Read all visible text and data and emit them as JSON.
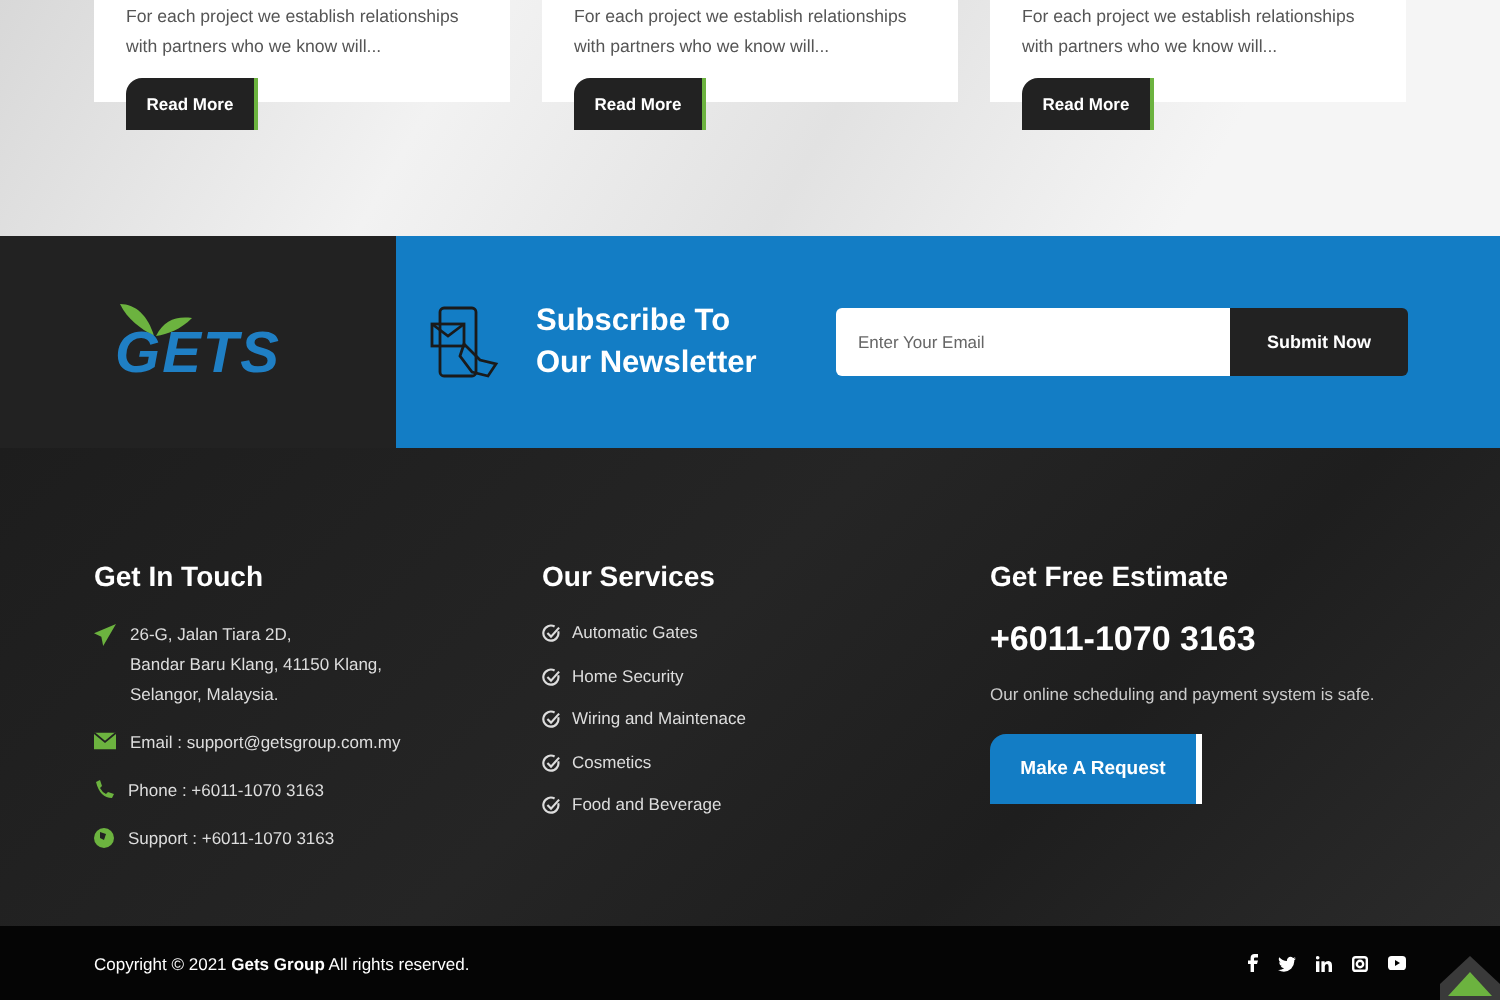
{
  "project_cards": [
    {
      "excerpt": [
        "For each project we establish relationships",
        "with partners who we know will..."
      ],
      "button": "Read More"
    },
    {
      "excerpt": [
        "For each project we establish relationships",
        "with partners who we know will..."
      ],
      "button": "Read More"
    },
    {
      "excerpt": [
        "For each project we establish relationships",
        "with partners who we know will..."
      ],
      "button": "Read More"
    }
  ],
  "logo": {
    "text": "GETS"
  },
  "newsletter": {
    "title": [
      "Subscribe To",
      "Our Newsletter"
    ],
    "email_placeholder": "Enter Your Email",
    "button": "Submit Now"
  },
  "get_in_touch": {
    "heading": "Get In Touch",
    "items": [
      {
        "kind": "address",
        "lines": [
          "26-G, Jalan Tiara 2D,",
          "Bandar Baru Klang, 41150 Klang,",
          "Selangor, Malaysia."
        ]
      },
      {
        "kind": "email",
        "lines": [
          "Email : support@getsgroup.com.my"
        ]
      },
      {
        "kind": "phone",
        "lines": [
          "Phone : +6011-1070 3163"
        ]
      },
      {
        "kind": "support",
        "lines": [
          "Support : +6011-1070 3163"
        ]
      }
    ]
  },
  "our_services": {
    "heading": "Our Services",
    "items": [
      "Automatic Gates",
      "Home Security",
      "Wiring and Maintenace",
      "Cosmetics",
      "Food and Beverage"
    ]
  },
  "estimate": {
    "heading": "Get Free Estimate",
    "phone": "+6011-1070 3163",
    "note": "Our online scheduling and payment system is safe.",
    "button": "Make A Request"
  },
  "copyright": "Copyright © 2021 **Gets Group** All rights reserved.",
  "social": [
    {
      "kind": "facebook"
    },
    {
      "kind": "twitter"
    },
    {
      "kind": "linkedin"
    },
    {
      "kind": "instagram"
    },
    {
      "kind": "youtube"
    }
  ]
}
